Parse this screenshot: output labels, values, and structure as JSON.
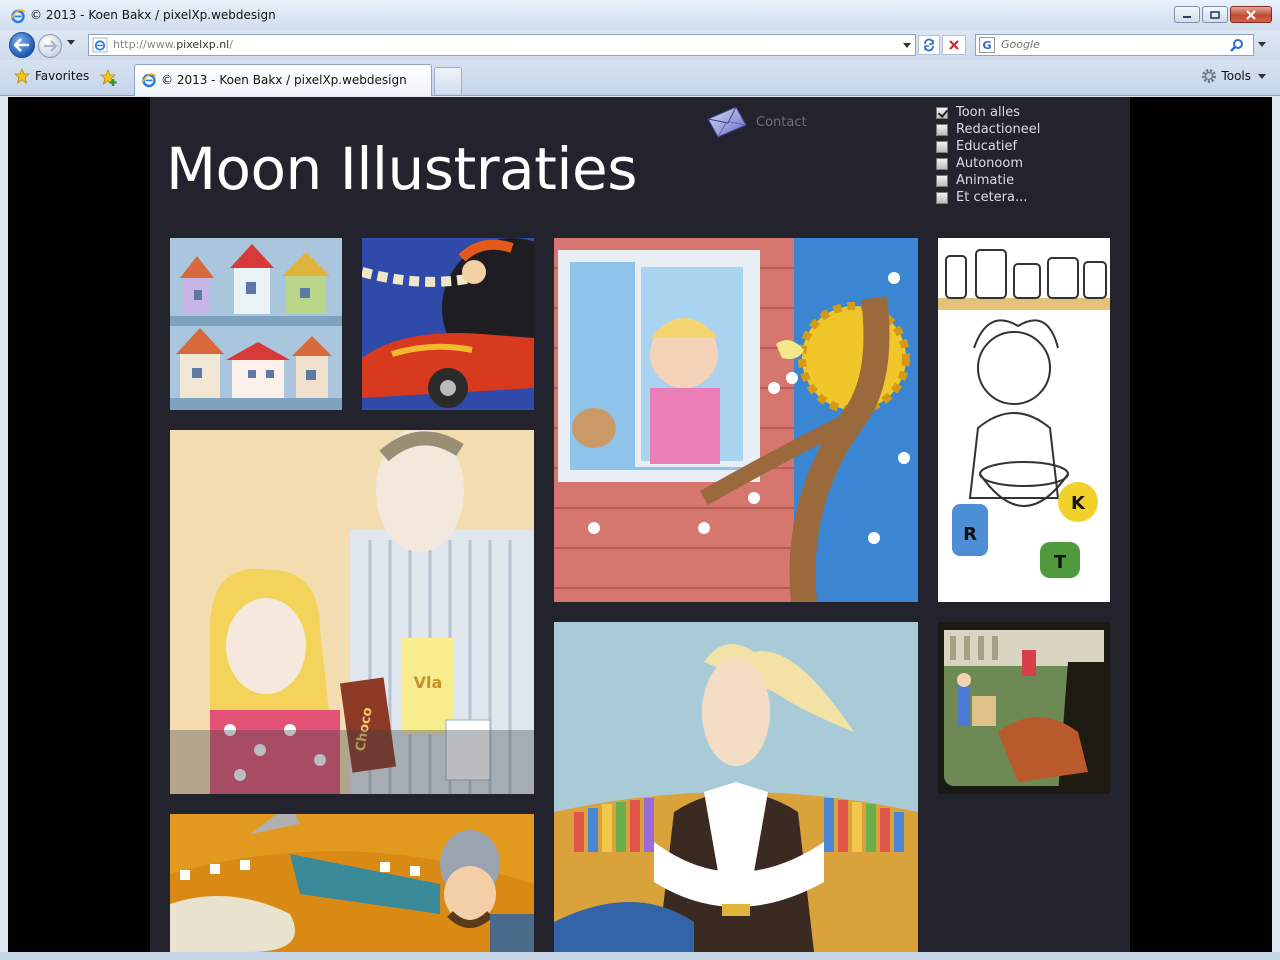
{
  "window": {
    "title": "© 2013 - Koen Bakx / pixelXp.webdesign"
  },
  "address_bar": {
    "url_prefix": "http://www.",
    "url_domain": "pixelxp.nl",
    "url_suffix": "/",
    "search_placeholder": "Google",
    "search_engine_letter": "G"
  },
  "tab_bar": {
    "favorites_label": "Favorites",
    "active_tab_title": "© 2013 - Koen Bakx / pixelXp.webdesign",
    "tools_label": "Tools"
  },
  "site": {
    "title": "Moon Illustraties",
    "contact_label": "Contact",
    "filters": [
      {
        "label": "Toon alles",
        "checked": true
      },
      {
        "label": "Redactioneel",
        "checked": false
      },
      {
        "label": "Educatief",
        "checked": false
      },
      {
        "label": "Autonoom",
        "checked": false
      },
      {
        "label": "Animatie",
        "checked": false
      },
      {
        "label": "Et cetera...",
        "checked": false
      }
    ],
    "illustration_text": {
      "vla": "Vla",
      "choco": "Choco",
      "jar_r": "R",
      "jar_k": "K",
      "jar_t": "T"
    }
  },
  "colors": {
    "site_background": "#23232e",
    "page_background": "#000000",
    "title_text": "#ffffff",
    "contact_text": "#6e6e7c"
  }
}
